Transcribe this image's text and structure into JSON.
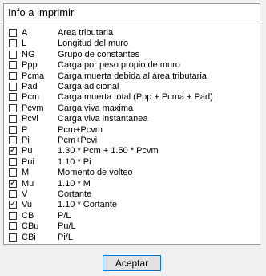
{
  "dialog": {
    "title": "Info a imprimir",
    "accept_label": "Aceptar"
  },
  "items": [
    {
      "code": "A",
      "desc": "Area tributaria",
      "checked": false
    },
    {
      "code": "L",
      "desc": "Longitud del muro",
      "checked": false
    },
    {
      "code": "NG",
      "desc": "Grupo de constantes",
      "checked": false
    },
    {
      "code": "Ppp",
      "desc": "Carga por peso propio de muro",
      "checked": false
    },
    {
      "code": "Pcma",
      "desc": "Carga muerta debida al área tributaria",
      "checked": false
    },
    {
      "code": "Pad",
      "desc": "Carga adicional",
      "checked": false
    },
    {
      "code": "Pcm",
      "desc": "Carga muerta total (Ppp + Pcma + Pad)",
      "checked": false
    },
    {
      "code": "Pcvm",
      "desc": "Carga viva maxima",
      "checked": false
    },
    {
      "code": "Pcvi",
      "desc": "Carga viva instantanea",
      "checked": false
    },
    {
      "code": "P",
      "desc": "Pcm+Pcvm",
      "checked": false
    },
    {
      "code": "Pi",
      "desc": "Pcm+Pcvi",
      "checked": false
    },
    {
      "code": "Pu",
      "desc": "1.30 * Pcm + 1.50 * Pcvm",
      "checked": true
    },
    {
      "code": "Pui",
      "desc": "1.10 * Pi",
      "checked": false
    },
    {
      "code": "M",
      "desc": "Momento de volteo",
      "checked": false
    },
    {
      "code": "Mu",
      "desc": "1.10 * M",
      "checked": true
    },
    {
      "code": "V",
      "desc": "Cortante",
      "checked": false
    },
    {
      "code": "Vu",
      "desc": "1.10 * Cortante",
      "checked": true
    },
    {
      "code": "CB",
      "desc": "P/L",
      "checked": false
    },
    {
      "code": "CBu",
      "desc": "Pu/L",
      "checked": false
    },
    {
      "code": "CBi",
      "desc": "Pi/L",
      "checked": false
    }
  ]
}
